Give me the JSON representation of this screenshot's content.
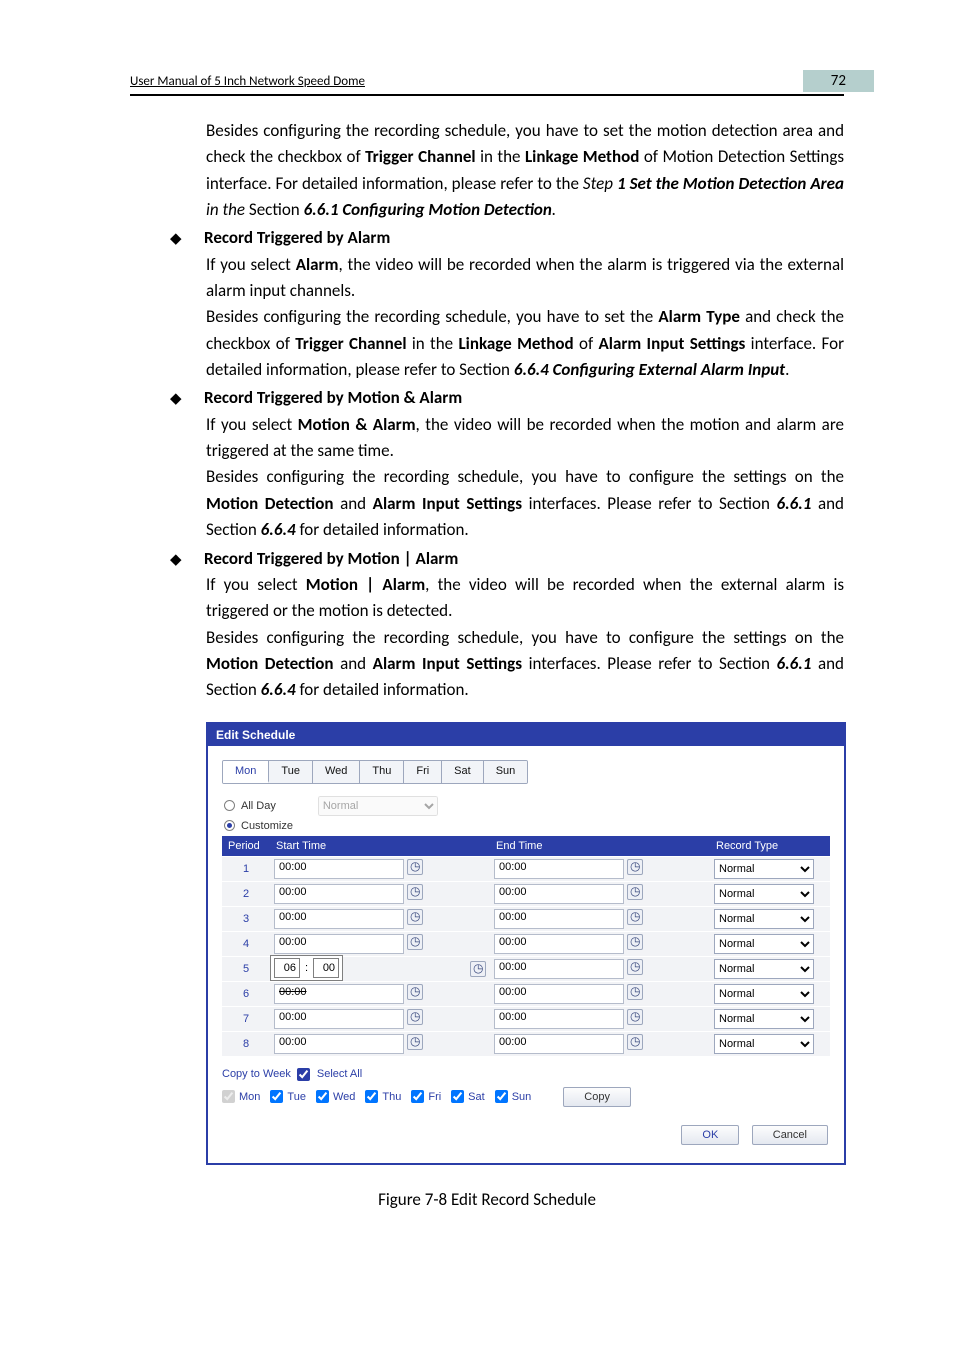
{
  "header": {
    "title": "User Manual of 5 Inch Network Speed Dome",
    "page_number": "72"
  },
  "para": {
    "intro_besides": "Besides configuring the recording schedule, you have to set the motion detection area and check the checkbox of ",
    "trigger_channel": "Trigger Channel",
    "in_the": " in the ",
    "linkage_method": "Linkage Method",
    "of_motion_detect": " of Motion Detection Settings interface. For detailed information, please refer to the ",
    "step_it": "Step ",
    "step1_b": "1",
    "set_md_area_i": " Set the Motion Detection Area",
    "in_the_it": " in the ",
    "section_word": "Section ",
    "conf_md_i": "6.6.1 Configuring Motion Detection",
    "period": "."
  },
  "s_alarm": {
    "heading": "Record Triggered by Alarm",
    "l1a": "If you select ",
    "alarm_b": "Alarm",
    "l1b": ", the video will be recorded when the alarm is triggered via the external alarm input channels.",
    "l2a": "Besides configuring the recording schedule, you have to set the ",
    "alarm_type_b": "Alarm Type",
    "l2b": " and check the checkbox of ",
    "trigger_channel_b": "Trigger Channel",
    "l2c": " in the ",
    "linkage_method_b": "Linkage Method",
    "l2d": " of ",
    "ais_b": "Alarm Input Settings",
    "l2e": " interface. For detailed information, please refer to Section ",
    "s664_bi": "6.6.4 Configuring External Alarm Input",
    "period": "."
  },
  "s_ma": {
    "heading": "Record Triggered by Motion & Alarm",
    "l1a": "If you select ",
    "ma_b": "Motion & Alarm",
    "l1b": ", the video will be recorded when the motion and alarm are triggered at the same time.",
    "l2a": "Besides configuring the recording schedule, you have to configure the settings on the ",
    "md_b": "Motion Detection",
    "l2b": " and ",
    "ais_b": "Alarm Input Settings",
    "l2c": " interfaces. Please refer to Section ",
    "s661_bi": "6.6.1",
    "l2d": " and Section ",
    "s664_bi": "6.6.4",
    "l2e": " for detailed information."
  },
  "s_moa": {
    "heading": "Record Triggered by Motion | Alarm",
    "l1a": "If you select ",
    "moa_b": "Motion | Alarm",
    "l1b": ", the video will be recorded when the external alarm is triggered or the motion is detected.",
    "l2a": "Besides configuring the recording schedule, you have to configure the settings on the ",
    "md_b": "Motion Detection",
    "l2b": " and ",
    "ais_b": "Alarm Input Settings",
    "l2c": " interfaces. Please refer to Section ",
    "s661_bi": "6.6.1",
    "l2d": " and Section ",
    "s664_bi": "6.6.4",
    "l2e": " for detailed information."
  },
  "dialog": {
    "title": "Edit Schedule",
    "tabs": [
      "Mon",
      "Tue",
      "Wed",
      "Thu",
      "Fri",
      "Sat",
      "Sun"
    ],
    "active_tab": "Mon",
    "all_day_label": "All Day",
    "all_day_type": "Normal",
    "customize_label": "Customize",
    "th_period": "Period",
    "th_start": "Start Time",
    "th_end": "End Time",
    "th_rec": "Record Type",
    "rows": [
      {
        "p": "1",
        "start": "00:00",
        "end": "00:00",
        "rec": "Normal"
      },
      {
        "p": "2",
        "start": "00:00",
        "end": "00:00",
        "rec": "Normal"
      },
      {
        "p": "3",
        "start": "00:00",
        "end": "00:00",
        "rec": "Normal"
      },
      {
        "p": "4",
        "start": "00:00",
        "end": "00:00",
        "rec": "Normal"
      },
      {
        "p": "5",
        "start": "",
        "start_hh": "06",
        "start_mm": "00",
        "end": "00:00",
        "rec": "Normal",
        "spinner": true
      },
      {
        "p": "6",
        "start": "00:00",
        "end": "00:00",
        "rec": "Normal",
        "strike": true
      },
      {
        "p": "7",
        "start": "00:00",
        "end": "00:00",
        "rec": "Normal"
      },
      {
        "p": "8",
        "start": "00:00",
        "end": "00:00",
        "rec": "Normal"
      }
    ],
    "copy_to_week": "Copy to Week",
    "select_all": "Select All",
    "days": [
      "Mon",
      "Tue",
      "Wed",
      "Thu",
      "Fri",
      "Sat",
      "Sun"
    ],
    "copy_btn": "Copy",
    "ok": "OK",
    "cancel": "Cancel"
  },
  "figure_caption": "Figure 7-8 Edit Record Schedule"
}
